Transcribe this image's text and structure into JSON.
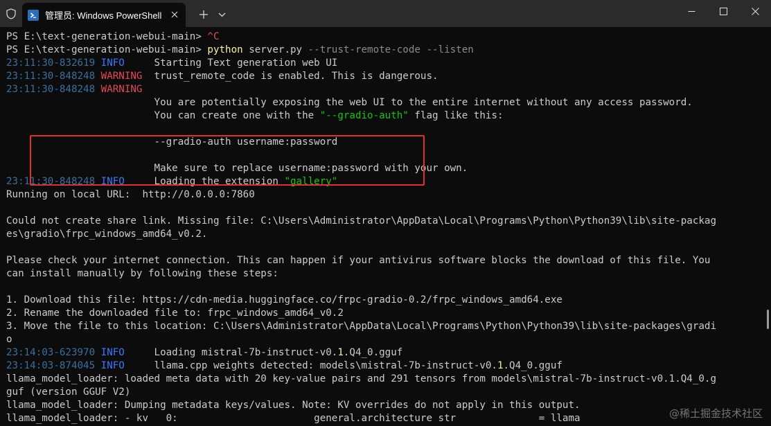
{
  "window": {
    "tab_title": "管理员: Windows PowerShell",
    "add_tab_label": "+",
    "controls": {
      "minimize": "minimize-icon",
      "maximize": "maximize-icon",
      "close": "close-icon"
    }
  },
  "colors": {
    "background": "#0c0c0c",
    "titlebar": "#2b2b2b",
    "timestamp": "#3a6f9e",
    "info": "#3b78ff",
    "warning": "#e74856",
    "command": "#f9f1a5",
    "argument": "#8a8a8a",
    "string": "#16c60c",
    "highlight_box": "#e02f2f"
  },
  "terminal": {
    "lines": [
      {
        "segments": [
          {
            "t": "PS E:\\text-generation-webui-main> "
          },
          {
            "t": "^C",
            "c": "red-text"
          }
        ]
      },
      {
        "segments": [
          {
            "t": "PS E:\\text-generation-webui-main> "
          },
          {
            "t": "python",
            "c": "yellow"
          },
          {
            "t": " server.py "
          },
          {
            "t": "--trust-remote-code --listen",
            "c": "gray"
          }
        ]
      },
      {
        "segments": [
          {
            "t": "23:11:30-832619",
            "c": "ts"
          },
          {
            "t": " "
          },
          {
            "t": "INFO",
            "c": "info"
          },
          {
            "t": "     Starting Text generation web UI"
          }
        ]
      },
      {
        "segments": [
          {
            "t": "23:11:30-848248",
            "c": "ts"
          },
          {
            "t": " "
          },
          {
            "t": "WARNING",
            "c": "warn"
          },
          {
            "t": "  trust_remote_code is enabled. This is dangerous."
          }
        ]
      },
      {
        "segments": [
          {
            "t": "23:11:30-848248",
            "c": "ts"
          },
          {
            "t": " "
          },
          {
            "t": "WARNING",
            "c": "warn"
          }
        ]
      },
      {
        "segments": [
          {
            "t": "                         You are potentially exposing the web UI to the entire internet without any access password."
          }
        ]
      },
      {
        "segments": [
          {
            "t": "                         You can create one with the "
          },
          {
            "t": "\"--gradio-auth\"",
            "c": "green"
          },
          {
            "t": " flag like this:"
          }
        ]
      },
      {
        "segments": [
          {
            "t": ""
          }
        ]
      },
      {
        "segments": [
          {
            "t": "                         --gradio-auth username:password"
          }
        ]
      },
      {
        "segments": [
          {
            "t": ""
          }
        ]
      },
      {
        "segments": [
          {
            "t": "                         Make sure to replace username:password with your own."
          }
        ]
      },
      {
        "segments": [
          {
            "t": "23:11:30-848248",
            "c": "ts"
          },
          {
            "t": " "
          },
          {
            "t": "INFO",
            "c": "info"
          },
          {
            "t": "     Loading the extension "
          },
          {
            "t": "\"gallery\"",
            "c": "green"
          }
        ]
      },
      {
        "segments": [
          {
            "t": "Running on local URL:  http://0.0.0.0:7860"
          }
        ]
      },
      {
        "segments": [
          {
            "t": ""
          }
        ]
      },
      {
        "segments": [
          {
            "t": "Could not create share link. Missing file: C:\\Users\\Administrator\\AppData\\Local\\Programs\\Python\\Python39\\lib\\site-packag"
          }
        ]
      },
      {
        "segments": [
          {
            "t": "es\\gradio\\frpc_windows_amd64_v0.2."
          }
        ]
      },
      {
        "segments": [
          {
            "t": ""
          }
        ]
      },
      {
        "segments": [
          {
            "t": "Please check your internet connection. This can happen if your antivirus software blocks the download of this file. You"
          }
        ]
      },
      {
        "segments": [
          {
            "t": "can install manually by following these steps:"
          }
        ]
      },
      {
        "segments": [
          {
            "t": ""
          }
        ]
      },
      {
        "segments": [
          {
            "t": "1. Download this file: https://cdn-media.huggingface.co/frpc-gradio-0.2/frpc_windows_amd64.exe"
          }
        ]
      },
      {
        "segments": [
          {
            "t": "2. Rename the downloaded file to: frpc_windows_amd64_v0.2"
          }
        ]
      },
      {
        "segments": [
          {
            "t": "3. Move the file to this location: C:\\Users\\Administrator\\AppData\\Local\\Programs\\Python\\Python39\\lib\\site-packages\\gradi"
          }
        ]
      },
      {
        "segments": [
          {
            "t": "o"
          }
        ]
      },
      {
        "segments": [
          {
            "t": "23:14:03-623970",
            "c": "ts"
          },
          {
            "t": " "
          },
          {
            "t": "INFO",
            "c": "info"
          },
          {
            "t": "     Loading mistral-7b-instruct-v0."
          },
          {
            "t": "1",
            "c": "num"
          },
          {
            "t": ".Q4_0.gguf"
          }
        ]
      },
      {
        "segments": [
          {
            "t": "23:14:03-874045",
            "c": "ts"
          },
          {
            "t": " "
          },
          {
            "t": "INFO",
            "c": "info"
          },
          {
            "t": "     llama.cpp weights detected: models\\mistral-7b-instruct-v0."
          },
          {
            "t": "1",
            "c": "num"
          },
          {
            "t": ".Q4_0.gguf"
          }
        ]
      },
      {
        "segments": [
          {
            "t": "llama_model_loader: loaded meta data with 20 key-value pairs and 291 tensors from models\\mistral-7b-instruct-v0.1.Q4_0.g"
          }
        ]
      },
      {
        "segments": [
          {
            "t": "guf (version GGUF V2)"
          }
        ]
      },
      {
        "segments": [
          {
            "t": "llama_model_loader: Dumping metadata keys/values. Note: KV overrides do not apply in this output."
          }
        ]
      },
      {
        "segments": [
          {
            "t": "llama_model_loader: - kv   0:                       general.architecture str              = llama"
          }
        ]
      }
    ]
  },
  "watermark": "@稀土掘金技术社区"
}
